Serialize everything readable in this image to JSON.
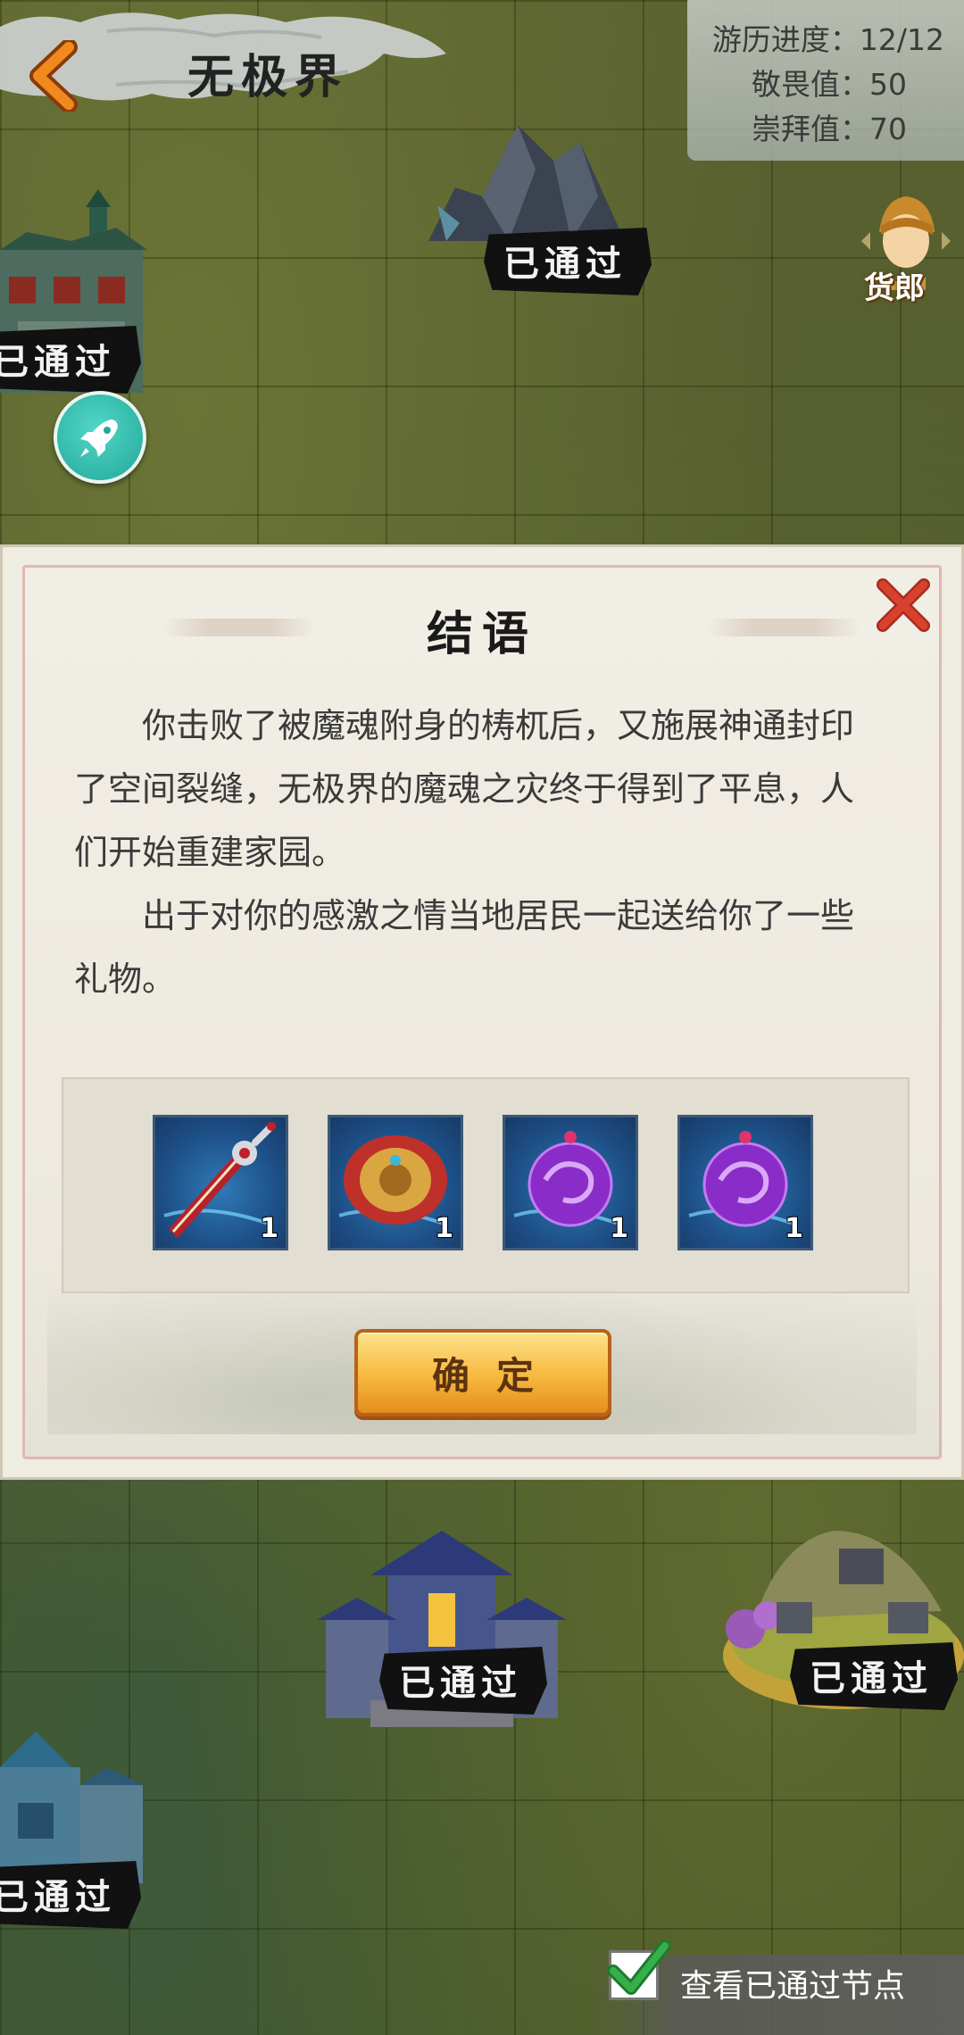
{
  "header": {
    "back_icon": "chevron-left-icon",
    "title": "无极界"
  },
  "stats": {
    "progress": "游历进度：12/12",
    "awe": "敬畏值：50",
    "worship": "崇拜值：70"
  },
  "map": {
    "nodes": [
      {
        "status": "已通过"
      },
      {
        "status": "已通过"
      },
      {
        "status": "已通过"
      },
      {
        "status": "已通过"
      },
      {
        "status": "已通过"
      }
    ],
    "merchant_label": "货郎",
    "rocket_icon": "rocket-icon"
  },
  "dialog": {
    "title": "结语",
    "close_icon": "close-icon",
    "paragraphs": [
      "你击败了被魔魂附身的梼杌后，又施展神通封印了空间裂缝，无极界的魔魂之灾终于得到了平息，人们开始重建家园。",
      "出于对你的感激之情当地居民一起送给你了一些礼物。"
    ],
    "rewards": [
      {
        "icon": "sword-icon",
        "qty": "1"
      },
      {
        "icon": "shield-icon",
        "qty": "1"
      },
      {
        "icon": "purple-orb-icon",
        "qty": "1"
      },
      {
        "icon": "purple-orb-icon",
        "qty": "1"
      }
    ],
    "confirm_label": "确定"
  },
  "footer": {
    "checkbox_checked": true,
    "view_passed_label": "查看已通过节点"
  },
  "colors": {
    "accent": "#f7b83d",
    "close": "#d9412f",
    "check": "#36b04a"
  }
}
